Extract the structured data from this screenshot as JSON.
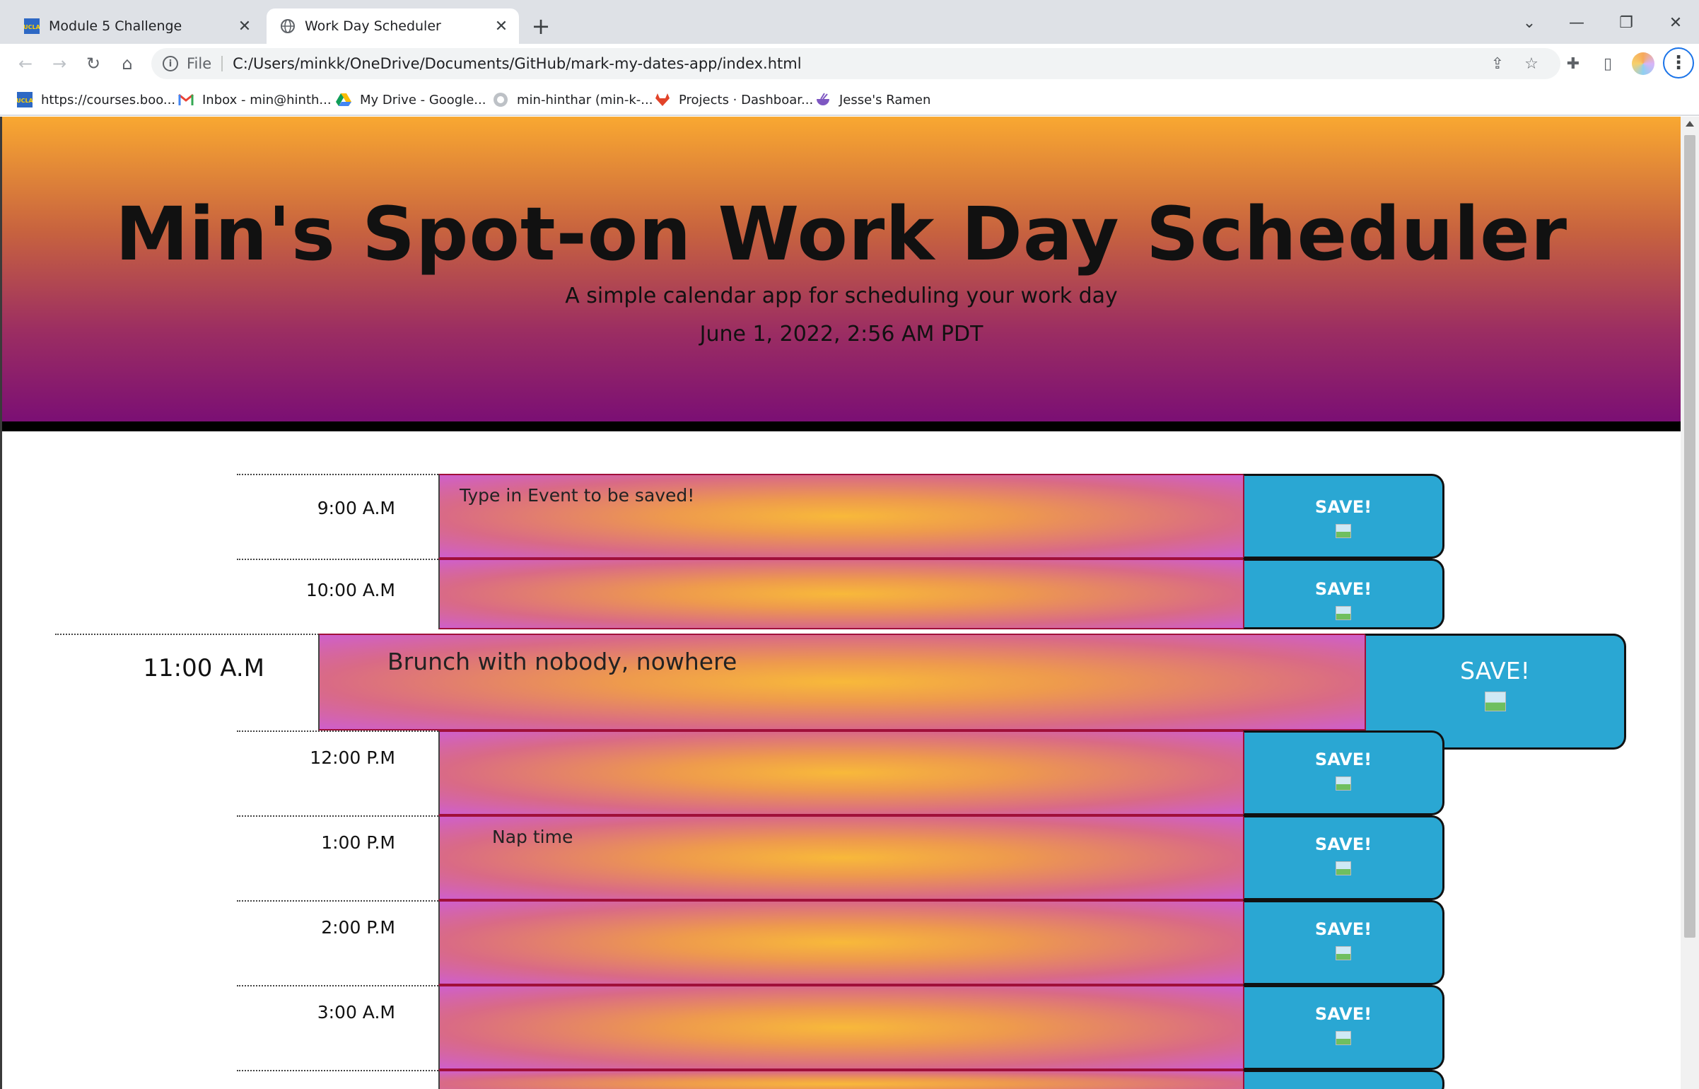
{
  "browser": {
    "tabs": [
      {
        "title": "Module 5 Challenge",
        "favicon": "ucla-icon",
        "active": false
      },
      {
        "title": "Work Day Scheduler",
        "favicon": "globe-icon",
        "active": true
      }
    ],
    "url_scheme": "File",
    "url": "C:/Users/minkk/OneDrive/Documents/GitHub/mark-my-dates-app/index.html",
    "bookmarks": [
      {
        "label": "https://courses.boo...",
        "icon": "ucla-icon"
      },
      {
        "label": "Inbox - min@hinth...",
        "icon": "gmail-icon"
      },
      {
        "label": "My Drive - Google...",
        "icon": "google-drive-icon"
      },
      {
        "label": "min-hinthar (min-k-...",
        "icon": "github-icon"
      },
      {
        "label": "Projects · Dashboar...",
        "icon": "gitlab-icon"
      },
      {
        "label": "Jesse's Ramen",
        "icon": "ramen-bowl-icon"
      }
    ]
  },
  "header": {
    "title": "Min's Spot-on Work Day Scheduler",
    "subtitle": "A simple calendar app for scheduling your work day",
    "current_date": "June 1, 2022, 2:56 AM PDT"
  },
  "schedule": {
    "save_label": "SAVE!",
    "rows": [
      {
        "hour": "9:00 A.M",
        "event": "Type in Event to be saved!"
      },
      {
        "hour": "10:00 A.M",
        "event": ""
      },
      {
        "hour": "11:00 A.M",
        "event": "Brunch with nobody, nowhere"
      },
      {
        "hour": "12:00 P.M",
        "event": ""
      },
      {
        "hour": "1:00 P.M",
        "event": "Nap time"
      },
      {
        "hour": "2:00 P.M",
        "event": ""
      },
      {
        "hour": "3:00 A.M",
        "event": ""
      },
      {
        "hour": "",
        "event": ""
      }
    ]
  },
  "colors": {
    "header_gradient_top": "#f9a831",
    "header_gradient_bottom": "#7b0f74",
    "save_button": "#2aa7d3",
    "row_border": "#a0103a"
  }
}
